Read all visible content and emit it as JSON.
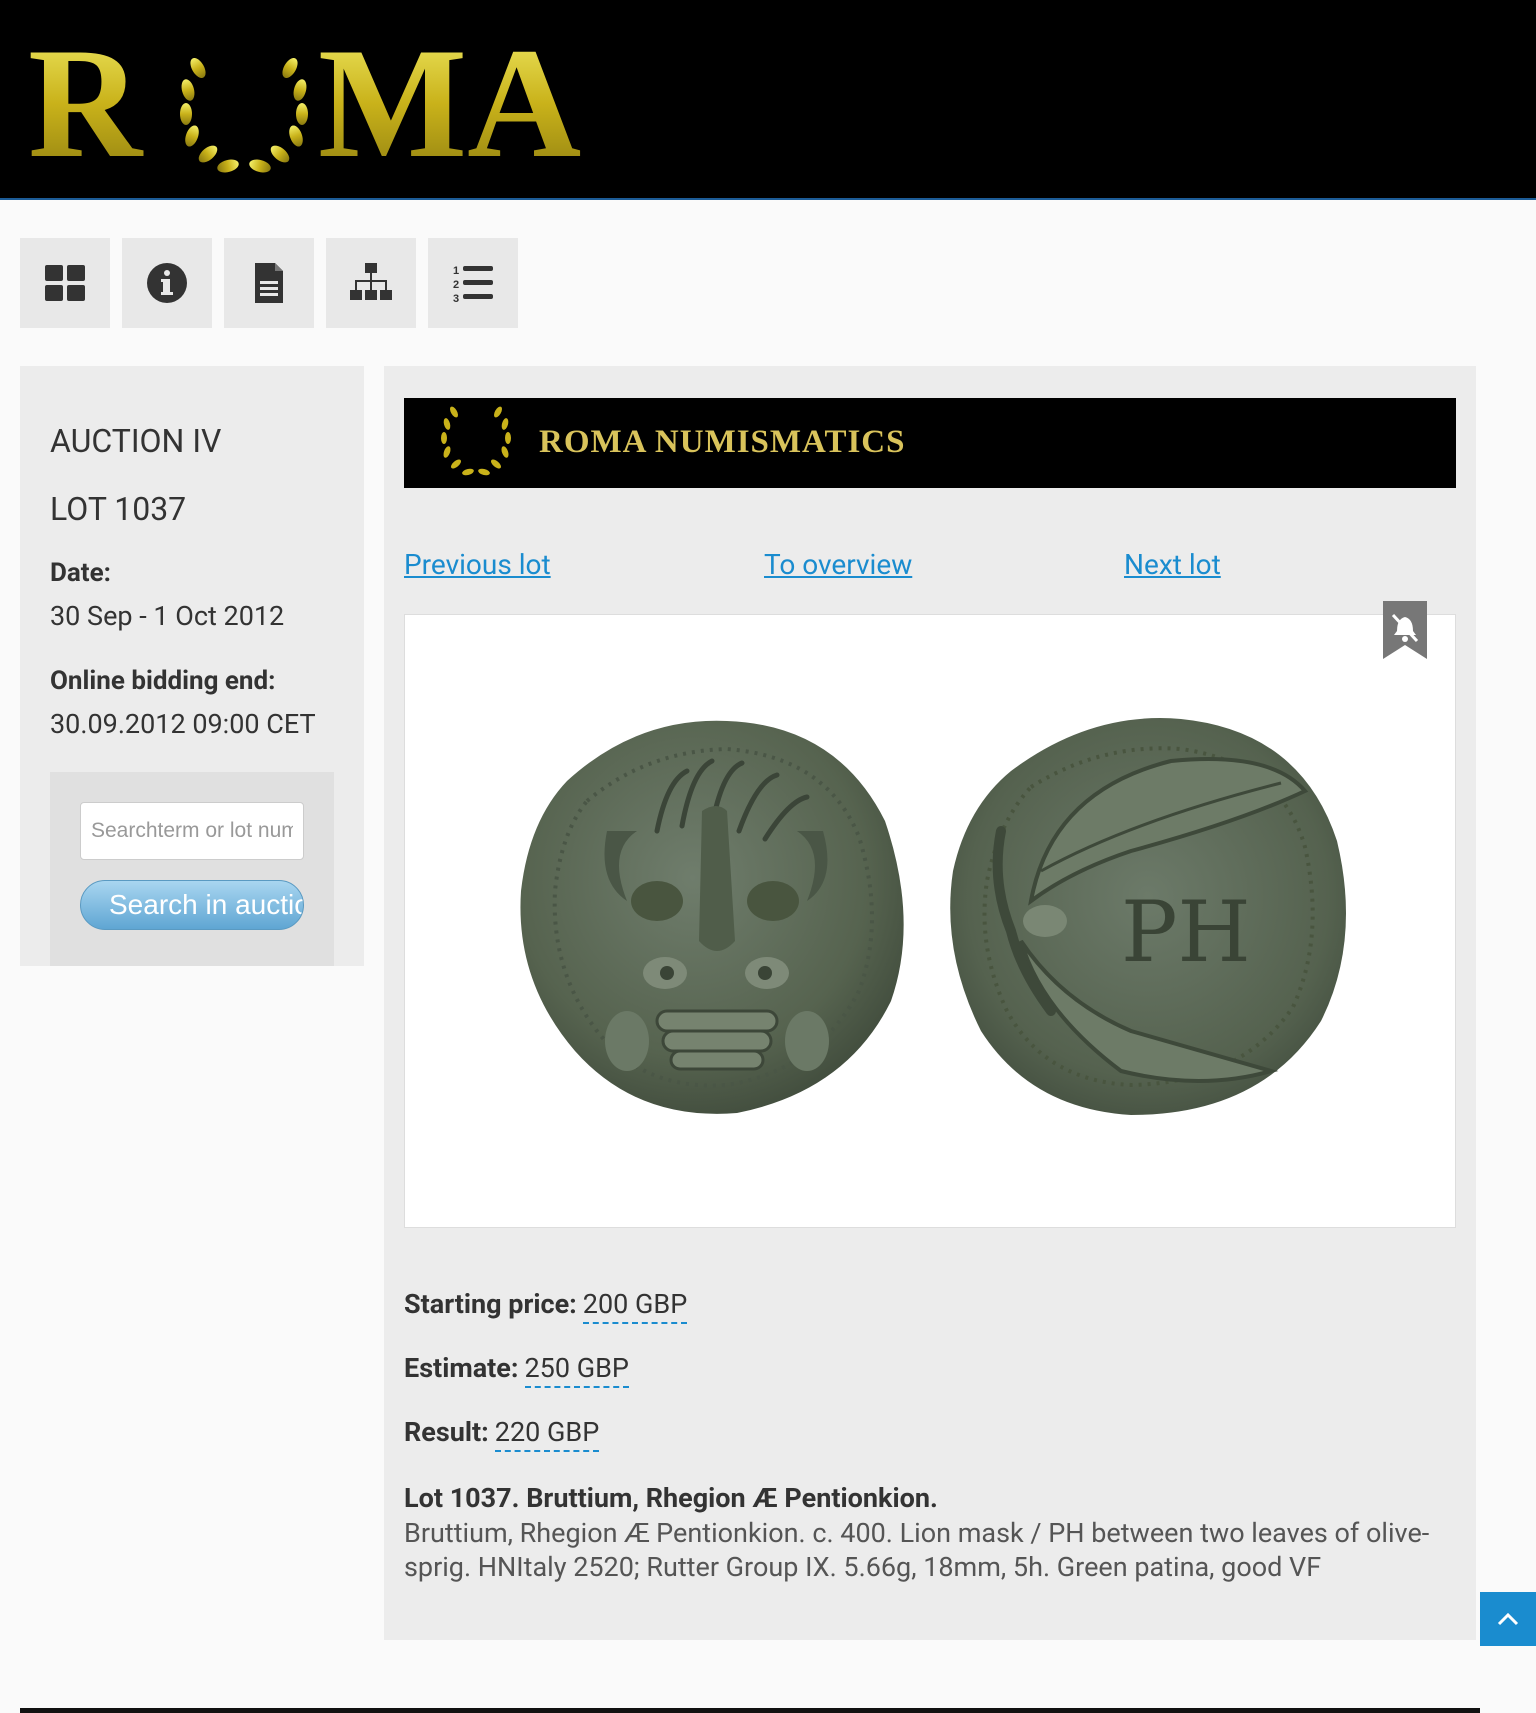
{
  "header": {
    "logo_text": "ROMA"
  },
  "toolbar": {
    "buttons": [
      {
        "icon": "grid-icon"
      },
      {
        "icon": "info-icon"
      },
      {
        "icon": "document-icon"
      },
      {
        "icon": "sitemap-icon"
      },
      {
        "icon": "numbered-list-icon"
      }
    ]
  },
  "sidebar": {
    "auction": "AUCTION IV",
    "lot": "LOT 1037",
    "date_label": "Date:",
    "date_value": "30 Sep - 1 Oct 2012",
    "bidding_label": "Online bidding end:",
    "bidding_value": "30.09.2012 09:00 CET",
    "search_placeholder": "Searchterm or lot number",
    "search_button": "Search in auction"
  },
  "main": {
    "banner_text": "ROMA NUMISMATICS",
    "nav": {
      "previous": "Previous lot",
      "overview": "To overview",
      "next": "Next lot"
    },
    "starting_price_label": "Starting price:",
    "starting_price_value": "200 GBP",
    "estimate_label": "Estimate:",
    "estimate_value": "250 GBP",
    "result_label": "Result:",
    "result_value": "220 GBP",
    "lot_title": "Lot 1037. Bruttium, Rhegion Æ Pentionkion.",
    "lot_description": "Bruttium, Rhegion Æ Pentionkion. c. 400. Lion mask / PH between two leaves of olive-sprig. HNItaly 2520; Rutter Group IX. 5.66g, 18mm, 5h. Green patina, good VF",
    "reverse_legend": "PH"
  },
  "colors": {
    "accent": "#1a8ccf",
    "header_bg": "#000000",
    "gold": "#d9c35b",
    "panel_bg": "#ececec"
  }
}
